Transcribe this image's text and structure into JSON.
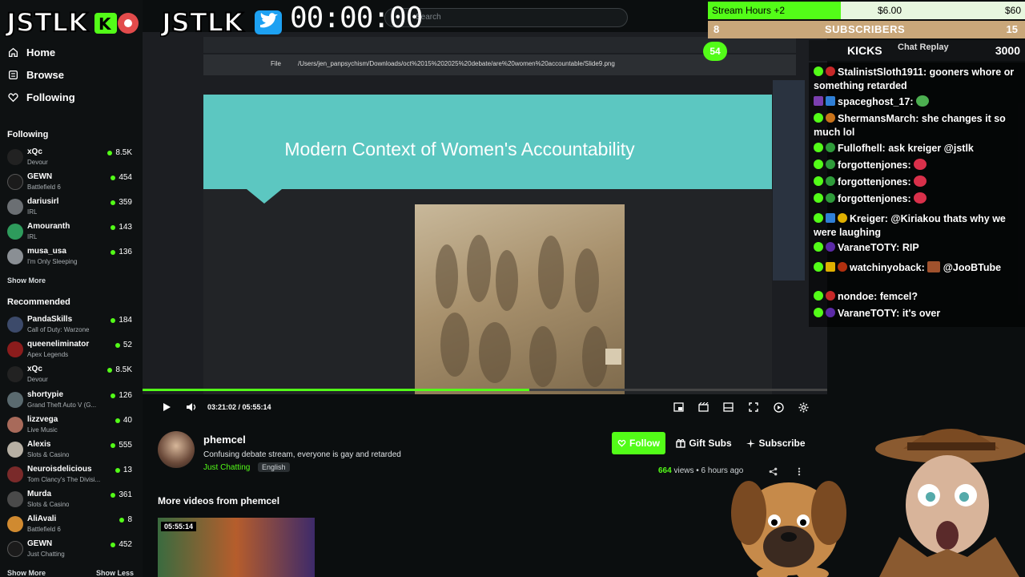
{
  "overlay": {
    "logo_text": "JSTLK",
    "logo_text_2": "JSTLK",
    "timer": "00:00:00",
    "search_placeholder": "Search"
  },
  "sidebar": {
    "nav": [
      {
        "label": "Home",
        "icon": "home-icon"
      },
      {
        "label": "Browse",
        "icon": "browse-icon"
      },
      {
        "label": "Following",
        "icon": "heart-icon"
      }
    ],
    "following_title": "Following",
    "following": [
      {
        "name": "xQc",
        "game": "Devour",
        "viewers": "8.5K"
      },
      {
        "name": "GEWN",
        "game": "Battlefield 6",
        "viewers": "454"
      },
      {
        "name": "dariusirl",
        "game": "IRL",
        "viewers": "359"
      },
      {
        "name": "Amouranth",
        "game": "IRL",
        "viewers": "143"
      },
      {
        "name": "musa_usa",
        "game": "I'm Only Sleeping",
        "viewers": "136"
      }
    ],
    "show_more_1": "Show More",
    "recommended_title": "Recommended",
    "recommended": [
      {
        "name": "PandaSkills",
        "game": "Call of Duty: Warzone",
        "viewers": "184"
      },
      {
        "name": "queeneliminator",
        "game": "Apex Legends",
        "viewers": "52"
      },
      {
        "name": "xQc",
        "game": "Devour",
        "viewers": "8.5K"
      },
      {
        "name": "shortypie",
        "game": "Grand Theft Auto V (G...",
        "viewers": "126"
      },
      {
        "name": "lizzvega",
        "game": "Live Music",
        "viewers": "40"
      },
      {
        "name": "Alexis",
        "game": "Slots & Casino",
        "viewers": "555"
      },
      {
        "name": "Neuroisdelicious",
        "game": "Tom Clancy's The Divisi...",
        "viewers": "13"
      },
      {
        "name": "Murda",
        "game": "Slots & Casino",
        "viewers": "361"
      },
      {
        "name": "AliAvali",
        "game": "Battlefield 6",
        "viewers": "8"
      },
      {
        "name": "GEWN",
        "game": "Just Chatting",
        "viewers": "452"
      }
    ],
    "show_more_2": "Show More",
    "show_less": "Show Less"
  },
  "video": {
    "url": "/Users/jen_panpsychism/Downloads/oct%2015%202025%20debate/are%20women%20accountable/Slide9.png",
    "file_label": "File",
    "slide_title": "Modern Context of Women's Accountability",
    "current_time": "03:21:02",
    "total_time": "05:55:14",
    "time_display": "03:21:02 / 05:55:14",
    "progress": 0.565
  },
  "channel": {
    "name": "phemcel",
    "title": "Confusing debate stream, everyone is gay and retarded",
    "category": "Just Chatting",
    "language": "English",
    "follow_label": "Follow",
    "gift_label": "Gift Subs",
    "subscribe_label": "Subscribe",
    "views": "664",
    "views_label": "views",
    "ago": "6 hours ago",
    "more_videos_title": "More videos from phemcel",
    "thumb_duration": "05:55:14"
  },
  "stream_stats": {
    "stream_hours_label": "Stream Hours +2",
    "mid_amount": "$6.00",
    "right_amount": "$60",
    "subs_current": "8",
    "subs_label": "SUBSCRIBERS",
    "subs_goal": "15",
    "kicks_label": "KICKS",
    "chat_replay_label": "Chat Replay",
    "kicks_goal": "3000",
    "badge_number": "54"
  },
  "chat": [
    {
      "user": "StalinistSloth1911:",
      "text": " gooners whore or something retarded",
      "color": "#c62828"
    },
    {
      "user": "spaceghost_17:",
      "text": "",
      "color": "#7b3fb0"
    },
    {
      "user": "ShermansMarch:",
      "text": " she changes it so much lol",
      "color": "#c9731a"
    },
    {
      "user": "Fullofhell:",
      "text": " ask kreiger @jstlk",
      "color": "#2e9b3a"
    },
    {
      "user": "forgottenjones:",
      "text": "",
      "color": "#2e9b3a"
    },
    {
      "user": "forgottenjones:",
      "text": "",
      "color": "#2e9b3a"
    },
    {
      "user": "forgottenjones:",
      "text": "",
      "color": "#2e9b3a"
    },
    {
      "user": "Kreiger:",
      "text": " @Kiriakou thats why we were laughing",
      "color": "#2f7fd6"
    },
    {
      "user": "VaraneTOTY:",
      "text": " RIP",
      "color": "#5b2aa6"
    },
    {
      "user": "watchinyoback:",
      "text": " @JooBTube",
      "color": "#b1300f"
    },
    {
      "user": "nondoe:",
      "text": " femcel?",
      "color": "#c62828"
    },
    {
      "user": "VaraneTOTY:",
      "text": " it's over",
      "color": "#5b2aa6"
    }
  ]
}
